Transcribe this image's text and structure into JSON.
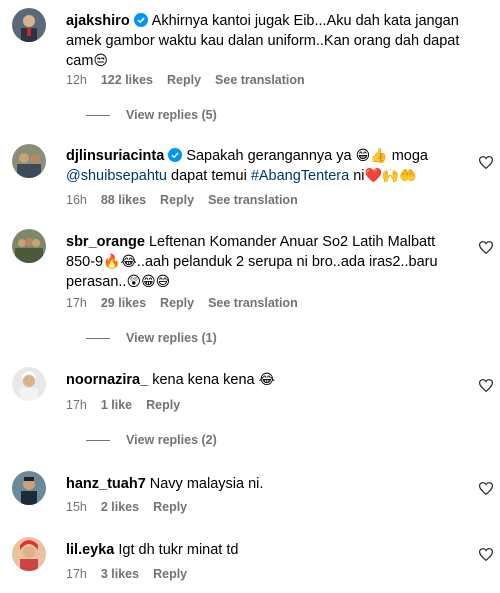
{
  "comments": [
    {
      "username": "ajakshiro",
      "text": "Akhirnya kantoi jugak Eib...Aku dah kata jangan amek gambor waktu kau dalan uniform..Kan orang dah dapat cam",
      "emoji": "😒",
      "time": "12h",
      "likes": "122 likes",
      "reply": "Reply",
      "translate": "See translation",
      "view_replies": "View replies (5)"
    },
    {
      "username": "djlinsuriacinta",
      "text_a": "Sapakah gerangannya ya",
      "emoji_a": "😁👍",
      "text_b": "moga",
      "mention": "@shuibsepahtu",
      "text_c": " dapat temui ",
      "hashtag": "#AbangTentera",
      "text_d": " ni",
      "emoji_b": "❤️🙌🤲",
      "time": "16h",
      "likes": "88 likes",
      "reply": "Reply",
      "translate": "See translation"
    },
    {
      "username": "sbr_orange",
      "text_a": "Leftenan Komander Anuar So2 Latih Malbatt 850-9",
      "emoji_a": "🔥😂",
      "text_b": "..aah pelanduk 2 serupa ni bro..ada iras2..baru perasan..",
      "emoji_b": "😲😁😅",
      "time": "17h",
      "likes": "29 likes",
      "reply": "Reply",
      "translate": "See translation",
      "view_replies": "View replies (1)"
    },
    {
      "username": "noornazira_",
      "text": "kena kena kena",
      "emoji": "😂",
      "time": "17h",
      "likes": "1 like",
      "reply": "Reply",
      "view_replies": "View replies (2)"
    },
    {
      "username": "hanz_tuah7",
      "text": "Navy malaysia ni.",
      "time": "15h",
      "likes": "2 likes",
      "reply": "Reply"
    },
    {
      "username": "lil.eyka",
      "text": "Igt dh tukr minat td",
      "time": "17h",
      "likes": "3 likes",
      "reply": "Reply"
    }
  ],
  "colors": {
    "text_primary": "#000000",
    "text_secondary": "#737373",
    "link": "#00376b",
    "verified": "#0095f6"
  },
  "icons": [
    "verified-badge-icon",
    "heart-icon"
  ]
}
